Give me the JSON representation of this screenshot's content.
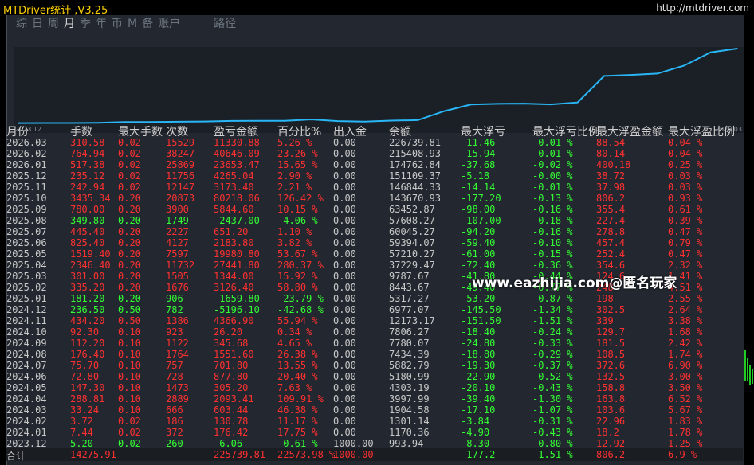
{
  "window": {
    "title": "MTDriver统计 ,V3.25",
    "url": "http://mtdriver.com"
  },
  "tabs": [
    {
      "label": "综",
      "active": false
    },
    {
      "label": "日",
      "active": false
    },
    {
      "label": "周",
      "active": false
    },
    {
      "label": "月",
      "active": true
    },
    {
      "label": "季",
      "active": false
    },
    {
      "label": "年",
      "active": false
    },
    {
      "label": "币",
      "active": false
    },
    {
      "label": "M",
      "active": false
    },
    {
      "label": "备",
      "active": false
    },
    {
      "label": "账户",
      "active": false
    },
    {
      "label": "路径",
      "active": false
    }
  ],
  "chart_data": {
    "type": "line",
    "x_start_label": "2023.12",
    "x_end_label": "2026.03",
    "line_color": "#29b6f6",
    "x": [
      "2023.12",
      "2024.01",
      "2024.02",
      "2024.03",
      "2024.04",
      "2024.05",
      "2024.06",
      "2024.07",
      "2024.08",
      "2024.09",
      "2024.10",
      "2024.11",
      "2024.12",
      "2025.01",
      "2025.02",
      "2025.03",
      "2025.04",
      "2025.05",
      "2025.06",
      "2025.07",
      "2025.08",
      "2025.09",
      "2025.10",
      "2025.11",
      "2025.12",
      "2026.01",
      "2026.02",
      "2026.03"
    ],
    "values": [
      993.94,
      1170.36,
      1301.14,
      1904.58,
      3997.99,
      4303.19,
      5180.99,
      5882.79,
      7434.39,
      7780.07,
      7806.27,
      12173.17,
      6977.07,
      5317.27,
      8443.67,
      9787.67,
      37229.47,
      57210.27,
      59394.07,
      60045.27,
      57608.27,
      63452.87,
      143670.93,
      146844.33,
      151109.37,
      174762.84,
      215408.93,
      226739.81
    ]
  },
  "headers": [
    "月份",
    "手数",
    "最大手数",
    "次数",
    "盈亏金额",
    "百分比%",
    "出入金",
    "余额",
    "最大浮亏",
    "最大浮亏比例",
    "最大浮盈金额",
    "最大浮盈比例"
  ],
  "rows": [
    {
      "m": "2026.03",
      "lots": "310.58",
      "maxlots": "0.02",
      "count": "15529",
      "pl": "11330.88",
      "pct": "5.26 %",
      "io": "0.00",
      "bal": "226739.81",
      "fl": "-11.46",
      "flp": "-0.01 %",
      "fg": "88.54",
      "fgp": "0.04 %",
      "pos": true
    },
    {
      "m": "2026.02",
      "lots": "764.94",
      "maxlots": "0.02",
      "count": "38247",
      "pl": "40646.09",
      "pct": "23.26 %",
      "io": "0.00",
      "bal": "215408.93",
      "fl": "-15.94",
      "flp": "-0.01 %",
      "fg": "80.14",
      "fgp": "0.04 %",
      "pos": true
    },
    {
      "m": "2026.01",
      "lots": "517.38",
      "maxlots": "0.02",
      "count": "25869",
      "pl": "23653.47",
      "pct": "15.65 %",
      "io": "0.00",
      "bal": "174762.84",
      "fl": "-37.68",
      "flp": "-0.02 %",
      "fg": "400.18",
      "fgp": "0.25 %",
      "pos": true
    },
    {
      "m": "2025.12",
      "lots": "235.12",
      "maxlots": "0.02",
      "count": "11756",
      "pl": "4265.04",
      "pct": "2.90 %",
      "io": "0.00",
      "bal": "151109.37",
      "fl": "-5.18",
      "flp": "-0.00 %",
      "fg": "38.72",
      "fgp": "0.03 %",
      "pos": true
    },
    {
      "m": "2025.11",
      "lots": "242.94",
      "maxlots": "0.02",
      "count": "12147",
      "pl": "3173.40",
      "pct": "2.21 %",
      "io": "0.00",
      "bal": "146844.33",
      "fl": "-14.14",
      "flp": "-0.01 %",
      "fg": "37.98",
      "fgp": "0.03 %",
      "pos": true
    },
    {
      "m": "2025.10",
      "lots": "3435.34",
      "maxlots": "0.20",
      "count": "20873",
      "pl": "80218.06",
      "pct": "126.42 %",
      "io": "0.00",
      "bal": "143670.93",
      "fl": "-177.20",
      "flp": "-0.13 %",
      "fg": "806.2",
      "fgp": "0.93 %",
      "pos": true
    },
    {
      "m": "2025.09",
      "lots": "780.00",
      "maxlots": "0.20",
      "count": "3900",
      "pl": "5844.60",
      "pct": "10.15 %",
      "io": "0.00",
      "bal": "63452.87",
      "fl": "-98.00",
      "flp": "-0.16 %",
      "fg": "355.4",
      "fgp": "0.61 %",
      "pos": true
    },
    {
      "m": "2025.08",
      "lots": "349.80",
      "maxlots": "0.20",
      "count": "1749",
      "pl": "-2437.00",
      "pct": "-4.06 %",
      "io": "0.00",
      "bal": "57608.27",
      "fl": "-107.00",
      "flp": "-0.18 %",
      "fg": "227.4",
      "fgp": "0.39 %",
      "pos": false
    },
    {
      "m": "2025.07",
      "lots": "445.40",
      "maxlots": "0.20",
      "count": "2227",
      "pl": "651.20",
      "pct": "1.10 %",
      "io": "0.00",
      "bal": "60045.27",
      "fl": "-94.20",
      "flp": "-0.16 %",
      "fg": "278.8",
      "fgp": "0.47 %",
      "pos": true
    },
    {
      "m": "2025.06",
      "lots": "825.40",
      "maxlots": "0.20",
      "count": "4127",
      "pl": "2183.80",
      "pct": "3.82 %",
      "io": "0.00",
      "bal": "59394.07",
      "fl": "-59.40",
      "flp": "-0.10 %",
      "fg": "457.4",
      "fgp": "0.79 %",
      "pos": true
    },
    {
      "m": "2025.05",
      "lots": "1519.40",
      "maxlots": "0.20",
      "count": "7597",
      "pl": "19980.80",
      "pct": "53.67 %",
      "io": "0.00",
      "bal": "57210.27",
      "fl": "-61.00",
      "flp": "-0.15 %",
      "fg": "252.4",
      "fgp": "0.47 %",
      "pos": true
    },
    {
      "m": "2025.04",
      "lots": "2346.40",
      "maxlots": "0.20",
      "count": "11732",
      "pl": "27441.80",
      "pct": "280.37 %",
      "io": "0.00",
      "bal": "37229.47",
      "fl": "-72.40",
      "flp": "-0.36 %",
      "fg": "354.6",
      "fgp": "2.32 %",
      "pos": true
    },
    {
      "m": "2025.03",
      "lots": "301.00",
      "maxlots": "0.20",
      "count": "1505",
      "pl": "1344.00",
      "pct": "15.92 %",
      "io": "0.00",
      "bal": "9787.67",
      "fl": "-41.80",
      "flp": "-0.44 %",
      "fg": "124.6",
      "fgp": "1.41 %",
      "pos": true
    },
    {
      "m": "2025.02",
      "lots": "335.20",
      "maxlots": "0.20",
      "count": "1676",
      "pl": "3126.40",
      "pct": "58.80 %",
      "io": "0.00",
      "bal": "8443.67",
      "fl": "-49.40",
      "flp": "-0.77 %",
      "fg": "248",
      "fgp": "4.51 %",
      "pos": true
    },
    {
      "m": "2025.01",
      "lots": "181.20",
      "maxlots": "0.20",
      "count": "906",
      "pl": "-1659.80",
      "pct": "-23.79 %",
      "io": "0.00",
      "bal": "5317.27",
      "fl": "-53.20",
      "flp": "-0.87 %",
      "fg": "198",
      "fgp": "2.55 %",
      "pos": false
    },
    {
      "m": "2024.12",
      "lots": "236.50",
      "maxlots": "0.50",
      "count": "782",
      "pl": "-5196.10",
      "pct": "-42.68 %",
      "io": "0.00",
      "bal": "6977.07",
      "fl": "-145.50",
      "flp": "-1.34 %",
      "fg": "302.5",
      "fgp": "2.64 %",
      "pos": false
    },
    {
      "m": "2024.11",
      "lots": "434.20",
      "maxlots": "0.50",
      "count": "1386",
      "pl": "4366.90",
      "pct": "55.94 %",
      "io": "0.00",
      "bal": "12173.17",
      "fl": "-151.50",
      "flp": "-1.51 %",
      "fg": "339",
      "fgp": "3.38 %",
      "pos": true
    },
    {
      "m": "2024.10",
      "lots": "92.30",
      "maxlots": "0.10",
      "count": "923",
      "pl": "26.20",
      "pct": "0.34 %",
      "io": "0.00",
      "bal": "7806.27",
      "fl": "-18.40",
      "flp": "-0.24 %",
      "fg": "129.7",
      "fgp": "1.68 %",
      "pos": true
    },
    {
      "m": "2024.09",
      "lots": "112.20",
      "maxlots": "0.10",
      "count": "1122",
      "pl": "345.68",
      "pct": "4.65 %",
      "io": "0.00",
      "bal": "7780.07",
      "fl": "-24.80",
      "flp": "-0.33 %",
      "fg": "181.5",
      "fgp": "2.42 %",
      "pos": true
    },
    {
      "m": "2024.08",
      "lots": "176.40",
      "maxlots": "0.10",
      "count": "1764",
      "pl": "1551.60",
      "pct": "26.38 %",
      "io": "0.00",
      "bal": "7434.39",
      "fl": "-18.80",
      "flp": "-0.29 %",
      "fg": "108.5",
      "fgp": "1.74 %",
      "pos": true
    },
    {
      "m": "2024.07",
      "lots": "75.70",
      "maxlots": "0.10",
      "count": "757",
      "pl": "701.80",
      "pct": "13.55 %",
      "io": "0.00",
      "bal": "5882.79",
      "fl": "-19.30",
      "flp": "-0.37 %",
      "fg": "372.6",
      "fgp": "6.90 %",
      "pos": true
    },
    {
      "m": "2024.06",
      "lots": "72.80",
      "maxlots": "0.10",
      "count": "728",
      "pl": "877.80",
      "pct": "20.40 %",
      "io": "0.00",
      "bal": "5180.99",
      "fl": "-22.90",
      "flp": "-0.52 %",
      "fg": "132.5",
      "fgp": "3.00 %",
      "pos": true
    },
    {
      "m": "2024.05",
      "lots": "147.30",
      "maxlots": "0.10",
      "count": "1473",
      "pl": "305.20",
      "pct": "7.63 %",
      "io": "0.00",
      "bal": "4303.19",
      "fl": "-20.10",
      "flp": "-0.43 %",
      "fg": "158.8",
      "fgp": "3.50 %",
      "pos": true
    },
    {
      "m": "2024.04",
      "lots": "288.81",
      "maxlots": "0.10",
      "count": "2889",
      "pl": "2093.41",
      "pct": "109.91 %",
      "io": "0.00",
      "bal": "3997.99",
      "fl": "-39.40",
      "flp": "-1.30 %",
      "fg": "163.8",
      "fgp": "6.52 %",
      "pos": true
    },
    {
      "m": "2024.03",
      "lots": "33.24",
      "maxlots": "0.10",
      "count": "666",
      "pl": "603.44",
      "pct": "46.38 %",
      "io": "0.00",
      "bal": "1904.58",
      "fl": "-17.10",
      "flp": "-1.07 %",
      "fg": "103.6",
      "fgp": "5.67 %",
      "pos": true
    },
    {
      "m": "2024.02",
      "lots": "3.72",
      "maxlots": "0.02",
      "count": "186",
      "pl": "130.78",
      "pct": "11.17 %",
      "io": "0.00",
      "bal": "1301.14",
      "fl": "-3.84",
      "flp": "-0.31 %",
      "fg": "22.96",
      "fgp": "1.83 %",
      "pos": true
    },
    {
      "m": "2024.01",
      "lots": "7.44",
      "maxlots": "0.02",
      "count": "372",
      "pl": "176.42",
      "pct": "17.75 %",
      "io": "0.00",
      "bal": "1170.36",
      "fl": "-4.90",
      "flp": "-0.43 %",
      "fg": "18.2",
      "fgp": "1.78 %",
      "pos": true
    },
    {
      "m": "2023.12",
      "lots": "5.20",
      "maxlots": "0.02",
      "count": "260",
      "pl": "-6.06",
      "pct": "-0.61 %",
      "io": "1000.00",
      "bal": "993.94",
      "fl": "-8.30",
      "flp": "-0.80 %",
      "fg": "12.92",
      "fgp": "1.25 %",
      "pos": false
    }
  ],
  "total": {
    "label": "合计",
    "lots": "14275.91",
    "pl": "225739.81",
    "pct": "22573.98 %",
    "io": "1000.00",
    "fl": "-177.2",
    "flp": "-1.51 %",
    "fg": "806.2",
    "fgp": "6.9 %"
  },
  "watermark": "www.eazhijia.com@匿名玩家"
}
